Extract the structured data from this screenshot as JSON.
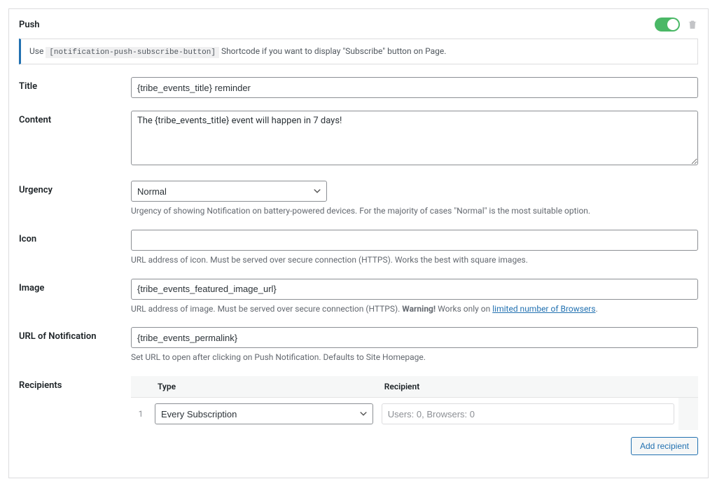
{
  "panel": {
    "title": "Push"
  },
  "banner": {
    "prefix": "Use ",
    "shortcode": "[notification-push-subscribe-button]",
    "suffix": " Shortcode if you want to display \"Subscribe\" button on Page."
  },
  "fields": {
    "title": {
      "label": "Title",
      "value": "{tribe_events_title} reminder"
    },
    "content": {
      "label": "Content",
      "value": "The {tribe_events_title} event will happen in 7 days!"
    },
    "urgency": {
      "label": "Urgency",
      "value": "Normal",
      "help": "Urgency of showing Notification on battery-powered devices. For the majority of cases \"Normal\" is the most suitable option."
    },
    "icon": {
      "label": "Icon",
      "value": "",
      "help": "URL address of icon. Must be served over secure connection (HTTPS). Works the best with square images."
    },
    "image": {
      "label": "Image",
      "value": "{tribe_events_featured_image_url}",
      "help_prefix": "URL address of image. Must be served over secure connection (HTTPS). ",
      "help_warning": "Warning!",
      "help_mid": " Works only on ",
      "help_link": "limited number of Browsers",
      "help_suffix": "."
    },
    "url": {
      "label": "URL of Notification",
      "value": "{tribe_events_permalink}",
      "help": "Set URL to open after clicking on Push Notification. Defaults to Site Homepage."
    },
    "recipients": {
      "label": "Recipients",
      "columns": {
        "type": "Type",
        "recipient": "Recipient"
      },
      "rows": [
        {
          "num": "1",
          "type": "Every Subscription",
          "recipient": "Users: 0, Browsers: 0"
        }
      ],
      "add_button": "Add recipient"
    }
  }
}
